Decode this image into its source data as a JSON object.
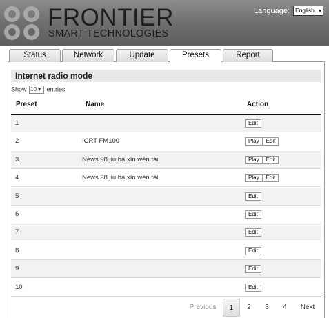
{
  "header": {
    "brand_title": "FRONTIER",
    "brand_subtitle": "SMART TECHNOLOGIES",
    "language_label": "Language:",
    "language_value": "English"
  },
  "tabs": [
    {
      "label": "Status"
    },
    {
      "label": "Network"
    },
    {
      "label": "Update"
    },
    {
      "label": "Presets",
      "active": true
    },
    {
      "label": "Report"
    }
  ],
  "section_title": "Internet radio mode",
  "length_control": {
    "prefix": "Show",
    "value": "10",
    "suffix": "entries"
  },
  "table": {
    "headers": {
      "preset": "Preset",
      "name": "Name",
      "action": "Action"
    },
    "rows": [
      {
        "preset": "1",
        "name": "",
        "actions": [
          "Edit"
        ]
      },
      {
        "preset": "2",
        "name": "ICRT FM100",
        "actions": [
          "Play",
          "Edit"
        ]
      },
      {
        "preset": "3",
        "name": "News 98 jiu bā xīn wén tái",
        "actions": [
          "Play",
          "Edit"
        ]
      },
      {
        "preset": "4",
        "name": "News 98 jiu bā xīn wén tái",
        "actions": [
          "Play",
          "Edit"
        ]
      },
      {
        "preset": "5",
        "name": "",
        "actions": [
          "Edit"
        ]
      },
      {
        "preset": "6",
        "name": "",
        "actions": [
          "Edit"
        ]
      },
      {
        "preset": "7",
        "name": "",
        "actions": [
          "Edit"
        ]
      },
      {
        "preset": "8",
        "name": "",
        "actions": [
          "Edit"
        ]
      },
      {
        "preset": "9",
        "name": "",
        "actions": [
          "Edit"
        ]
      },
      {
        "preset": "10",
        "name": "",
        "actions": [
          "Edit"
        ]
      }
    ]
  },
  "pagination": {
    "previous": "Previous",
    "pages": [
      "1",
      "2",
      "3",
      "4"
    ],
    "current": "1",
    "next": "Next"
  },
  "icons": {
    "language_dropdown": "chevron-down-icon",
    "length_dropdown": "chevron-down-icon",
    "logo": "frontier-logo-circles"
  }
}
